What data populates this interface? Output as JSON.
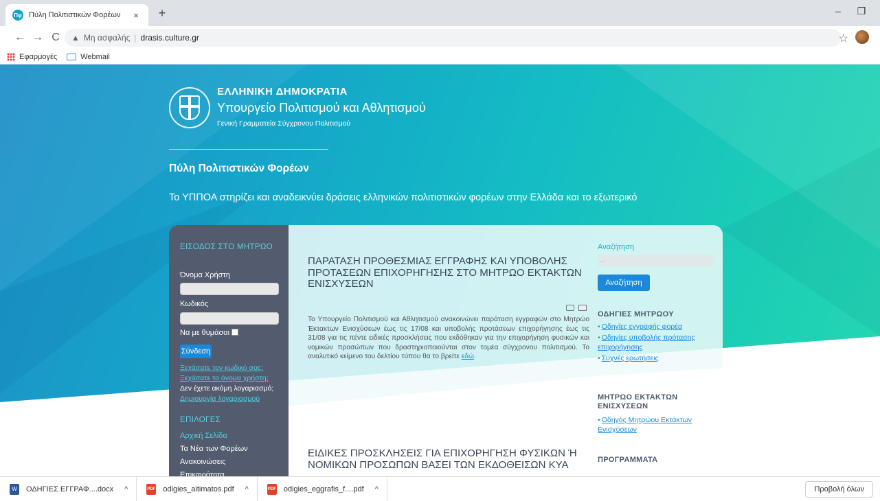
{
  "browser": {
    "tab_title": "Πύλη Πολιτιστικών Φορέων",
    "tab_favicon_text": "Πφ",
    "close_glyph": "×",
    "newtab_glyph": "+",
    "minimize_glyph": "–",
    "restore_glyph": "❐",
    "nav_back": "←",
    "nav_forward": "→",
    "nav_reload": "C",
    "security_label": "Μη ασφαλής",
    "url_separator": "|",
    "url": "drasis.culture.gr",
    "bookmarks": [
      "Εφαρμογές",
      "Webmail"
    ]
  },
  "header": {
    "org": "ΕΛΛΗΝΙΚΗ ΔΗΜΟΚΡΑΤΙΑ",
    "ministry": "Υπουργείο Πολιτισμού και Αθλητισμού",
    "secretariat": "Γενική Γραμματεία Σύγχρονου Πολιτισμού",
    "portal_title": "Πύλη Πολιτιστικών Φορέων",
    "tagline": "Το ΥΠΠΟΑ στηρίζει και αναδεικνύει δράσεις ελληνικών πολιτιστικών φορέων στην Ελλάδα και το εξωτερικό"
  },
  "sidebar": {
    "login_heading": "ΕΙΣΟΔΟΣ ΣΤΟ ΜΗΤΡΩΟ",
    "username_label": "Όνομα Χρήστη",
    "password_label": "Κωδικός",
    "remember_label": "Να με θυμάσαι",
    "login_button": "Σύνδεση",
    "forgot_password": "Ξεχάσατε τον κωδικό σας;",
    "forgot_username": "Ξεχάσατε το όνομα χρήστη;",
    "no_account": "Δεν έχετε ακόμη λογαριασμό;",
    "create_account": "Δημιουργία λογαριασμού",
    "options_heading": "ΕΠΙΛΟΓΕΣ",
    "menu": [
      "Αρχική Σελίδα",
      "Τα Νέα των Φορέων",
      "Ανακοινώσεις",
      "Επικαιρότητα"
    ]
  },
  "main": {
    "article1_title": "ΠΑΡΑΤΑΣΗ ΠΡΟΘΕΣΜΙΑΣ ΕΓΓΡΑΦΗΣ ΚΑΙ ΥΠΟΒΟΛΗΣ ΠΡΟΤΑΣΕΩΝ ΕΠΙΧΟΡΗΓΗΣΗΣ ΣΤΟ ΜΗΤΡΩΟ ΕΚΤΑΚΤΩΝ ΕΝΙΣΧΥΣΕΩΝ",
    "article1_body": "Το Υπουργείο Πολιτισμού και Αθλητισμού ανακοινώνει παράταση εγγραφών στο Μητρώο Έκτακτων Ενισχύσεων έως τις 17/08 και υποβολής προτάσεων επιχορήγησης έως τις 31/08 για τις πέντε ειδικές προσκλήσεις που εκδόθηκαν για την επιχορήγηση φυσικών και νομικών προσώπων που δραστηριοποιούνται στον τομέα σύγχρονου πολιτισμού. Το αναλυτικό κείμενο του δελτίου τύπου θα το βρείτε ",
    "article1_link": "εδώ",
    "article1_end": ".",
    "article2_title": "ΕΙΔΙΚΕΣ ΠΡΟΣΚΛΗΣΕΙΣ ΓΙΑ ΕΠΙΧΟΡΗΓΗΣΗ ΦΥΣΙΚΩΝ Ή ΝΟΜΙΚΩΝ ΠΡΟΣΩΠΩΝ ΒΑΣΕΙ ΤΩΝ ΕΚΔΟΘΕΙΣΩΝ ΚΥΑ"
  },
  "right": {
    "search_label": "Αναζήτηση",
    "search_placeholder": "...",
    "search_button": "Αναζήτηση",
    "guides_heading": "ΟΔΗΓΙΕΣ ΜΗΤΡΩΟΥ",
    "guide_links": [
      "Οδηγίες εγγραφής φορέα",
      "Οδηγίες υποβολής πρότασης επιχορήγησης",
      "Συχνές ερωτήσεις"
    ],
    "registry_heading": "ΜΗΤΡΩΟ ΕΚΤΑΚΤΩΝ ΕΝΙΣΧΥΣΕΩΝ",
    "registry_link": "Οδηγός Μητρώου Εκτάκτων Ενισχύσεων",
    "programs_heading": "ΠΡΟΓΡΑΜΜΑΤΑ"
  },
  "downloads": {
    "items": [
      "ΟΔΗΓΙΕΣ ΕΓΓΡΑΦ....docx",
      "odigies_aitimatos.pdf",
      "odigies_eggrafis_f....pdf"
    ],
    "chevron": "^",
    "show_all": "Προβολή όλων"
  },
  "icons": {
    "security": "warning-triangle-icon",
    "star": "star-icon",
    "apps": "apps-grid-icon",
    "mail": "mail-icon"
  },
  "colors": {
    "accent": "#1b88d9",
    "sidebar": "#535b6e",
    "link_cyan": "#4fd0e6"
  }
}
